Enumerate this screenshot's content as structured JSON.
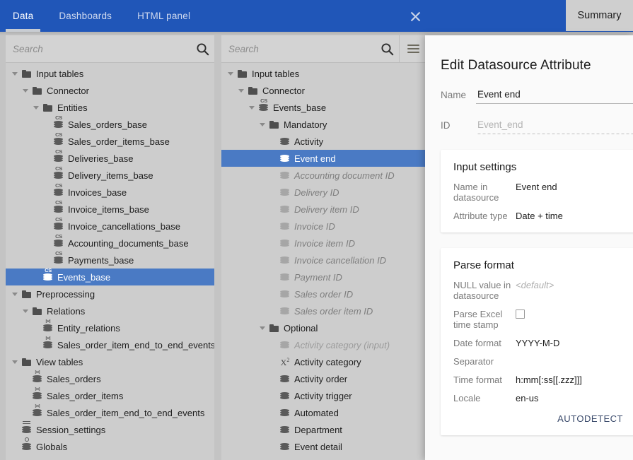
{
  "header": {
    "tabs": [
      {
        "label": "Data",
        "active": true
      },
      {
        "label": "Dashboards",
        "active": false
      },
      {
        "label": "HTML panel",
        "active": false
      }
    ],
    "close_label": "×",
    "summary_tab": "Summary",
    "accent_color": "#2056b8",
    "selection_color": "#4a7ac4"
  },
  "left_panel": {
    "search_placeholder": "Search",
    "tree": [
      {
        "label": "Input tables",
        "depth": 0,
        "icon": "folder-icon",
        "caret": true
      },
      {
        "label": "Connector",
        "depth": 1,
        "icon": "folder-icon",
        "caret": true
      },
      {
        "label": "Entities",
        "depth": 2,
        "icon": "folder-icon",
        "caret": true
      },
      {
        "label": "Sales_orders_base",
        "depth": 3,
        "icon": "cs-table-icon"
      },
      {
        "label": "Sales_order_items_base",
        "depth": 3,
        "icon": "cs-table-icon"
      },
      {
        "label": "Deliveries_base",
        "depth": 3,
        "icon": "cs-table-icon"
      },
      {
        "label": "Delivery_items_base",
        "depth": 3,
        "icon": "cs-table-icon"
      },
      {
        "label": "Invoices_base",
        "depth": 3,
        "icon": "cs-table-icon"
      },
      {
        "label": "Invoice_items_base",
        "depth": 3,
        "icon": "cs-table-icon"
      },
      {
        "label": "Invoice_cancellations_base",
        "depth": 3,
        "icon": "cs-table-icon"
      },
      {
        "label": "Accounting_documents_base",
        "depth": 3,
        "icon": "cs-table-icon"
      },
      {
        "label": "Payments_base",
        "depth": 3,
        "icon": "cs-table-icon"
      },
      {
        "label": "Events_base",
        "depth": 2,
        "icon": "cs-table-icon",
        "selected": true
      },
      {
        "label": "Preprocessing",
        "depth": 0,
        "icon": "folder-icon",
        "caret": true
      },
      {
        "label": "Relations",
        "depth": 1,
        "icon": "folder-icon",
        "caret": true
      },
      {
        "label": "Entity_relations",
        "depth": 2,
        "icon": "join-table-icon"
      },
      {
        "label": "Sales_order_item_end_to_end_events_base",
        "depth": 2,
        "icon": "join-table-icon"
      },
      {
        "label": "View tables",
        "depth": 0,
        "icon": "folder-icon",
        "caret": true
      },
      {
        "label": "Sales_orders",
        "depth": 1,
        "icon": "join-table-icon"
      },
      {
        "label": "Sales_order_items",
        "depth": 1,
        "icon": "join-table-icon"
      },
      {
        "label": "Sales_order_item_end_to_end_events",
        "depth": 1,
        "icon": "join-table-icon"
      },
      {
        "label": "Session_settings",
        "depth": 0,
        "icon": "settings-table-icon"
      },
      {
        "label": "Globals",
        "depth": 0,
        "icon": "globals-table-icon"
      }
    ]
  },
  "mid_panel": {
    "search_placeholder": "Search",
    "menu_icon": "hamburger-menu-icon",
    "tree": [
      {
        "label": "Input tables",
        "depth": 0,
        "icon": "folder-icon",
        "caret": true
      },
      {
        "label": "Connector",
        "depth": 1,
        "icon": "folder-icon",
        "caret": true
      },
      {
        "label": "Events_base",
        "depth": 2,
        "icon": "cs-table-icon",
        "caret": true
      },
      {
        "label": "Mandatory",
        "depth": 3,
        "icon": "folder-icon",
        "caret": true
      },
      {
        "label": "Activity",
        "depth": 4,
        "icon": "attribute-icon"
      },
      {
        "label": "Event end",
        "depth": 4,
        "icon": "attribute-icon",
        "selected": true
      },
      {
        "label": "Accounting document ID",
        "depth": 4,
        "icon": "attribute-icon",
        "dim": true
      },
      {
        "label": "Delivery ID",
        "depth": 4,
        "icon": "attribute-icon",
        "dim": true
      },
      {
        "label": "Delivery item ID",
        "depth": 4,
        "icon": "attribute-icon",
        "dim": true
      },
      {
        "label": "Invoice ID",
        "depth": 4,
        "icon": "attribute-icon",
        "dim": true
      },
      {
        "label": "Invoice item ID",
        "depth": 4,
        "icon": "attribute-icon",
        "dim": true
      },
      {
        "label": "Invoice cancellation ID",
        "depth": 4,
        "icon": "attribute-icon",
        "dim": true
      },
      {
        "label": "Payment ID",
        "depth": 4,
        "icon": "attribute-icon",
        "dim": true
      },
      {
        "label": "Sales order ID",
        "depth": 4,
        "icon": "attribute-icon",
        "dim": true
      },
      {
        "label": "Sales order item ID",
        "depth": 4,
        "icon": "attribute-icon",
        "dim": true
      },
      {
        "label": "Optional",
        "depth": 3,
        "icon": "folder-icon",
        "caret": true
      },
      {
        "label": "Activity category (input)",
        "depth": 4,
        "icon": "attribute-icon",
        "dim2": true
      },
      {
        "label": "Activity category",
        "depth": 4,
        "icon": "formula-attribute-icon"
      },
      {
        "label": "Activity order",
        "depth": 4,
        "icon": "attribute-icon"
      },
      {
        "label": "Activity trigger",
        "depth": 4,
        "icon": "attribute-icon"
      },
      {
        "label": "Automated",
        "depth": 4,
        "icon": "attribute-icon"
      },
      {
        "label": "Department",
        "depth": 4,
        "icon": "attribute-icon"
      },
      {
        "label": "Event detail",
        "depth": 4,
        "icon": "attribute-icon"
      }
    ]
  },
  "dialog": {
    "title": "Edit Datasource Attribute",
    "name_label": "Name",
    "name_value": "Event end",
    "id_label": "ID",
    "id_value": "Event_end",
    "input_settings": {
      "heading": "Input settings",
      "rows": [
        {
          "key": "Name in datasource",
          "value": "Event end"
        },
        {
          "key": "Attribute type",
          "value": "Date + time"
        }
      ]
    },
    "parse_format": {
      "heading": "Parse format",
      "null_value_label": "NULL value in datasource",
      "null_value_placeholder": "<default>",
      "parse_excel_label": "Parse Excel time stamp",
      "parse_excel_checked": false,
      "rows": [
        {
          "key": "Date format",
          "value": "YYYY-M-D"
        },
        {
          "key": "Separator",
          "value": ""
        },
        {
          "key": "Time format",
          "value": "h:mm[:ss[[.zzz]]]"
        },
        {
          "key": "Locale",
          "value": "en-us"
        }
      ],
      "autodetect_label": "AUTODETECT"
    }
  }
}
